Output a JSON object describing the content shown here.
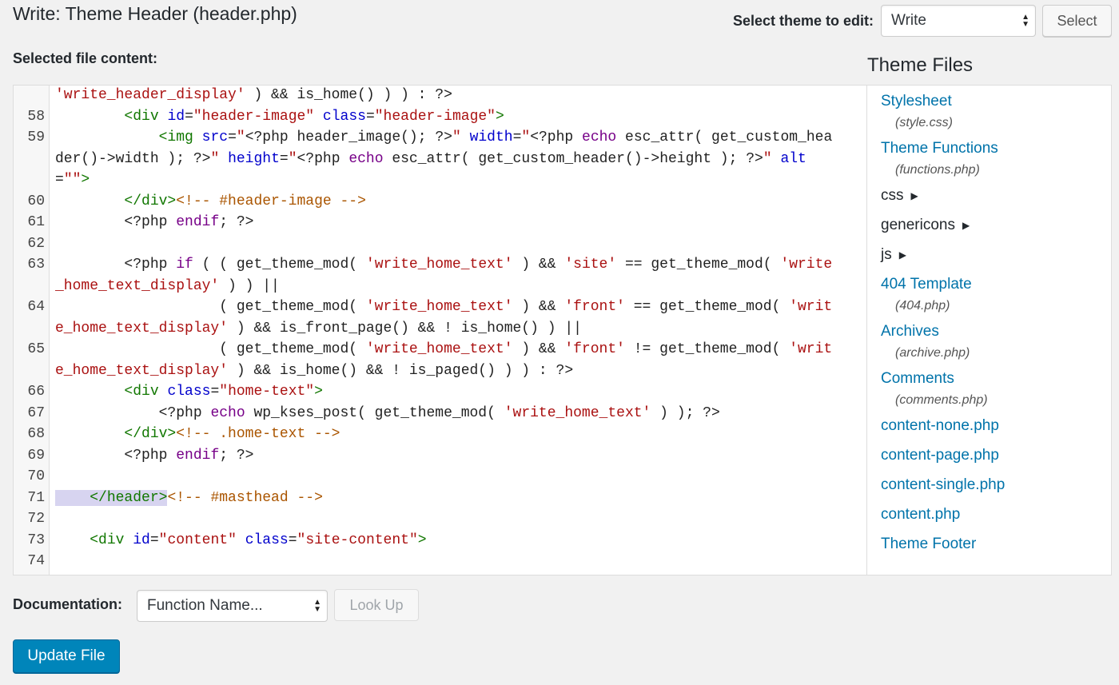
{
  "header": {
    "title": "Write: Theme Header (header.php)",
    "select_theme_label": "Select theme to edit:",
    "selected_theme": "Write",
    "select_button": "Select"
  },
  "editor": {
    "label": "Selected file content:",
    "lines": [
      {
        "num": "",
        "html": "<span style=\"color:#a11\">'write_header_display'</span> ) &amp;&amp; is_home() ) ) : ?&gt;"
      },
      {
        "num": "58",
        "html": "        <span style=\"color:#170\">&lt;div</span> <span style=\"color:#00c\">id</span>=<span style=\"color:#a11\">\"header-image\"</span> <span style=\"color:#00c\">class</span>=<span style=\"color:#a11\">\"header-image\"</span><span style=\"color:#170\">&gt;</span>"
      },
      {
        "num": "59",
        "html": "            <span style=\"color:#170\">&lt;img</span> <span style=\"color:#00c\">src</span>=<span style=\"color:#a11\">\"</span>&lt;?php header_image(); ?&gt;<span style=\"color:#a11\">\"</span> <span style=\"color:#00c\">width</span>=<span style=\"color:#a11\">\"</span>&lt;?php <span style=\"color:#708\">echo</span> esc_attr( get_custom_header()-&gt;width ); ?&gt;<span style=\"color:#a11\">\"</span> <span style=\"color:#00c\">height</span>=<span style=\"color:#a11\">\"</span>&lt;?php <span style=\"color:#708\">echo</span> esc_attr( get_custom_header()-&gt;height ); ?&gt;<span style=\"color:#a11\">\"</span> <span style=\"color:#00c\">alt</span>=<span style=\"color:#a11\">\"\"</span><span style=\"color:#170\">&gt;</span>"
      },
      {
        "num": "60",
        "html": "        <span style=\"color:#170\">&lt;/div&gt;</span><span style=\"color:#a50\">&lt;!-- #header-image --&gt;</span>"
      },
      {
        "num": "61",
        "html": "        &lt;?php <span style=\"color:#708\">endif</span>; ?&gt;"
      },
      {
        "num": "62",
        "html": " "
      },
      {
        "num": "63",
        "html": "        &lt;?php <span style=\"color:#708\">if</span> ( ( get_theme_mod( <span style=\"color:#a11\">'write_home_text'</span> ) &amp;&amp; <span style=\"color:#a11\">'site'</span> == get_theme_mod( <span style=\"color:#a11\">'write_home_text_display'</span> ) ) ||"
      },
      {
        "num": "64",
        "html": "                   ( get_theme_mod( <span style=\"color:#a11\">'write_home_text'</span> ) &amp;&amp; <span style=\"color:#a11\">'front'</span> == get_theme_mod( <span style=\"color:#a11\">'write_home_text_display'</span> ) &amp;&amp; is_front_page() &amp;&amp; ! is_home() ) ||"
      },
      {
        "num": "65",
        "html": "                   ( get_theme_mod( <span style=\"color:#a11\">'write_home_text'</span> ) &amp;&amp; <span style=\"color:#a11\">'front'</span> != get_theme_mod( <span style=\"color:#a11\">'write_home_text_display'</span> ) &amp;&amp; is_home() &amp;&amp; ! is_paged() ) ) : ?&gt;"
      },
      {
        "num": "66",
        "html": "        <span style=\"color:#170\">&lt;div</span> <span style=\"color:#00c\">class</span>=<span style=\"color:#a11\">\"home-text\"</span><span style=\"color:#170\">&gt;</span>"
      },
      {
        "num": "67",
        "html": "            &lt;?php <span style=\"color:#708\">echo</span> wp_kses_post( get_theme_mod( <span style=\"color:#a11\">'write_home_text'</span> ) ); ?&gt;"
      },
      {
        "num": "68",
        "html": "        <span style=\"color:#170\">&lt;/div&gt;</span><span style=\"color:#a50\">&lt;!-- .home-text --&gt;</span>"
      },
      {
        "num": "69",
        "html": "        &lt;?php <span style=\"color:#708\">endif</span>; ?&gt;"
      },
      {
        "num": "70",
        "html": " "
      },
      {
        "num": "71",
        "html": "<span class=\"hl\">    <span style=\"color:#170\">&lt;/header&gt;</span></span><span style=\"color:#a50\">&lt;!-- #masthead --&gt;</span>"
      },
      {
        "num": "72",
        "html": " "
      },
      {
        "num": "73",
        "html": "    <span style=\"color:#170\">&lt;div</span> <span style=\"color:#00c\">id</span>=<span style=\"color:#a11\">\"content\"</span> <span style=\"color:#00c\">class</span>=<span style=\"color:#a11\">\"site-content\"</span><span style=\"color:#170\">&gt;</span>"
      },
      {
        "num": "74",
        "html": " "
      }
    ]
  },
  "sidebar": {
    "title": "Theme Files",
    "items": [
      {
        "type": "file",
        "name": "Stylesheet",
        "sub": "(style.css)",
        "slug": "stylesheet"
      },
      {
        "type": "file",
        "name": "Theme Functions",
        "sub": "(functions.php)",
        "slug": "theme-functions"
      },
      {
        "type": "folder",
        "name": "css",
        "slug": "css"
      },
      {
        "type": "folder",
        "name": "genericons",
        "slug": "genericons"
      },
      {
        "type": "folder",
        "name": "js",
        "slug": "js"
      },
      {
        "type": "file",
        "name": "404 Template",
        "sub": "(404.php)",
        "slug": "404-template"
      },
      {
        "type": "file",
        "name": "Archives",
        "sub": "(archive.php)",
        "slug": "archives"
      },
      {
        "type": "file",
        "name": "Comments",
        "sub": "(comments.php)",
        "slug": "comments"
      },
      {
        "type": "file",
        "name": "content-none.php",
        "sub": "",
        "slug": "content-none"
      },
      {
        "type": "file",
        "name": "content-page.php",
        "sub": "",
        "slug": "content-page"
      },
      {
        "type": "file",
        "name": "content-single.php",
        "sub": "",
        "slug": "content-single"
      },
      {
        "type": "file",
        "name": "content.php",
        "sub": "",
        "slug": "content"
      },
      {
        "type": "file",
        "name": "Theme Footer",
        "sub": "",
        "slug": "theme-footer"
      }
    ]
  },
  "footer": {
    "doc_label": "Documentation:",
    "doc_select": "Function Name...",
    "lookup_button": "Look Up",
    "update_button": "Update File"
  },
  "colors": {
    "link": "#0073aa",
    "primary_button": "#0085ba",
    "selection": "#d7d4f0"
  }
}
